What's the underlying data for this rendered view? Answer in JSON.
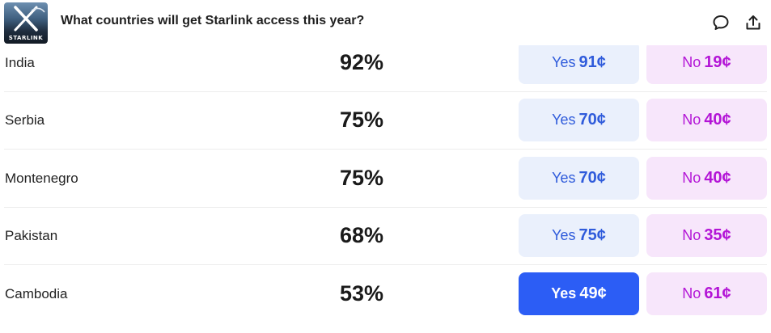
{
  "header": {
    "title": "What countries will get Starlink access this year?",
    "logo_text": "STARLINK",
    "comment_icon": "comment-icon",
    "share_icon": "share-icon"
  },
  "rows": [
    {
      "country": "India",
      "pct": "92%",
      "yes_label": "Yes",
      "yes_price": "91¢",
      "no_label": "No",
      "no_price": "19¢"
    },
    {
      "country": "Serbia",
      "pct": "75%",
      "yes_label": "Yes",
      "yes_price": "70¢",
      "no_label": "No",
      "no_price": "40¢"
    },
    {
      "country": "Montenegro",
      "pct": "75%",
      "yes_label": "Yes",
      "yes_price": "70¢",
      "no_label": "No",
      "no_price": "40¢"
    },
    {
      "country": "Pakistan",
      "pct": "68%",
      "yes_label": "Yes",
      "yes_price": "75¢",
      "no_label": "No",
      "no_price": "35¢"
    },
    {
      "country": "Cambodia",
      "pct": "53%",
      "yes_label": "Yes",
      "yes_price": "49¢",
      "no_label": "No",
      "no_price": "61¢"
    }
  ],
  "colors": {
    "yes_bg": "#eaf0fc",
    "yes_text": "#2f5bdb",
    "yes_active_bg": "#2c5df5",
    "no_bg": "#f7e6fb",
    "no_text": "#b314d6"
  }
}
